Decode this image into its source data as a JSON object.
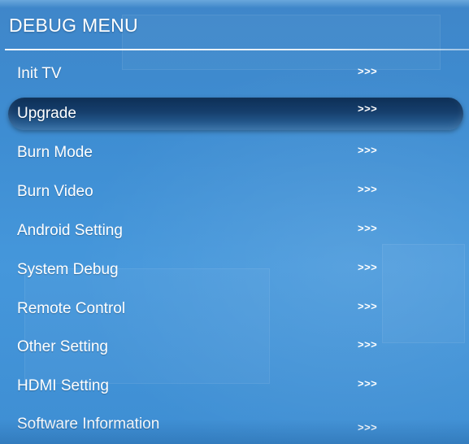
{
  "menu": {
    "title": "DEBUG MENU",
    "selected_index": 1,
    "items": [
      {
        "label": "Init TV",
        "arrows": ">>>"
      },
      {
        "label": "Upgrade",
        "arrows": ">>>"
      },
      {
        "label": "Burn Mode",
        "arrows": ">>>"
      },
      {
        "label": "Burn Video",
        "arrows": ">>>"
      },
      {
        "label": "Android Setting",
        "arrows": ">>>"
      },
      {
        "label": "System Debug",
        "arrows": ">>>"
      },
      {
        "label": "Remote Control",
        "arrows": ">>>"
      },
      {
        "label": "Other Setting",
        "arrows": ">>>"
      },
      {
        "label": "HDMI Setting",
        "arrows": ">>>"
      },
      {
        "label": "Software Information",
        "arrows": ">>>"
      }
    ]
  },
  "colors": {
    "background": "#3e8dd2",
    "selected_highlight": "#163f6d",
    "text": "#ffffff"
  }
}
